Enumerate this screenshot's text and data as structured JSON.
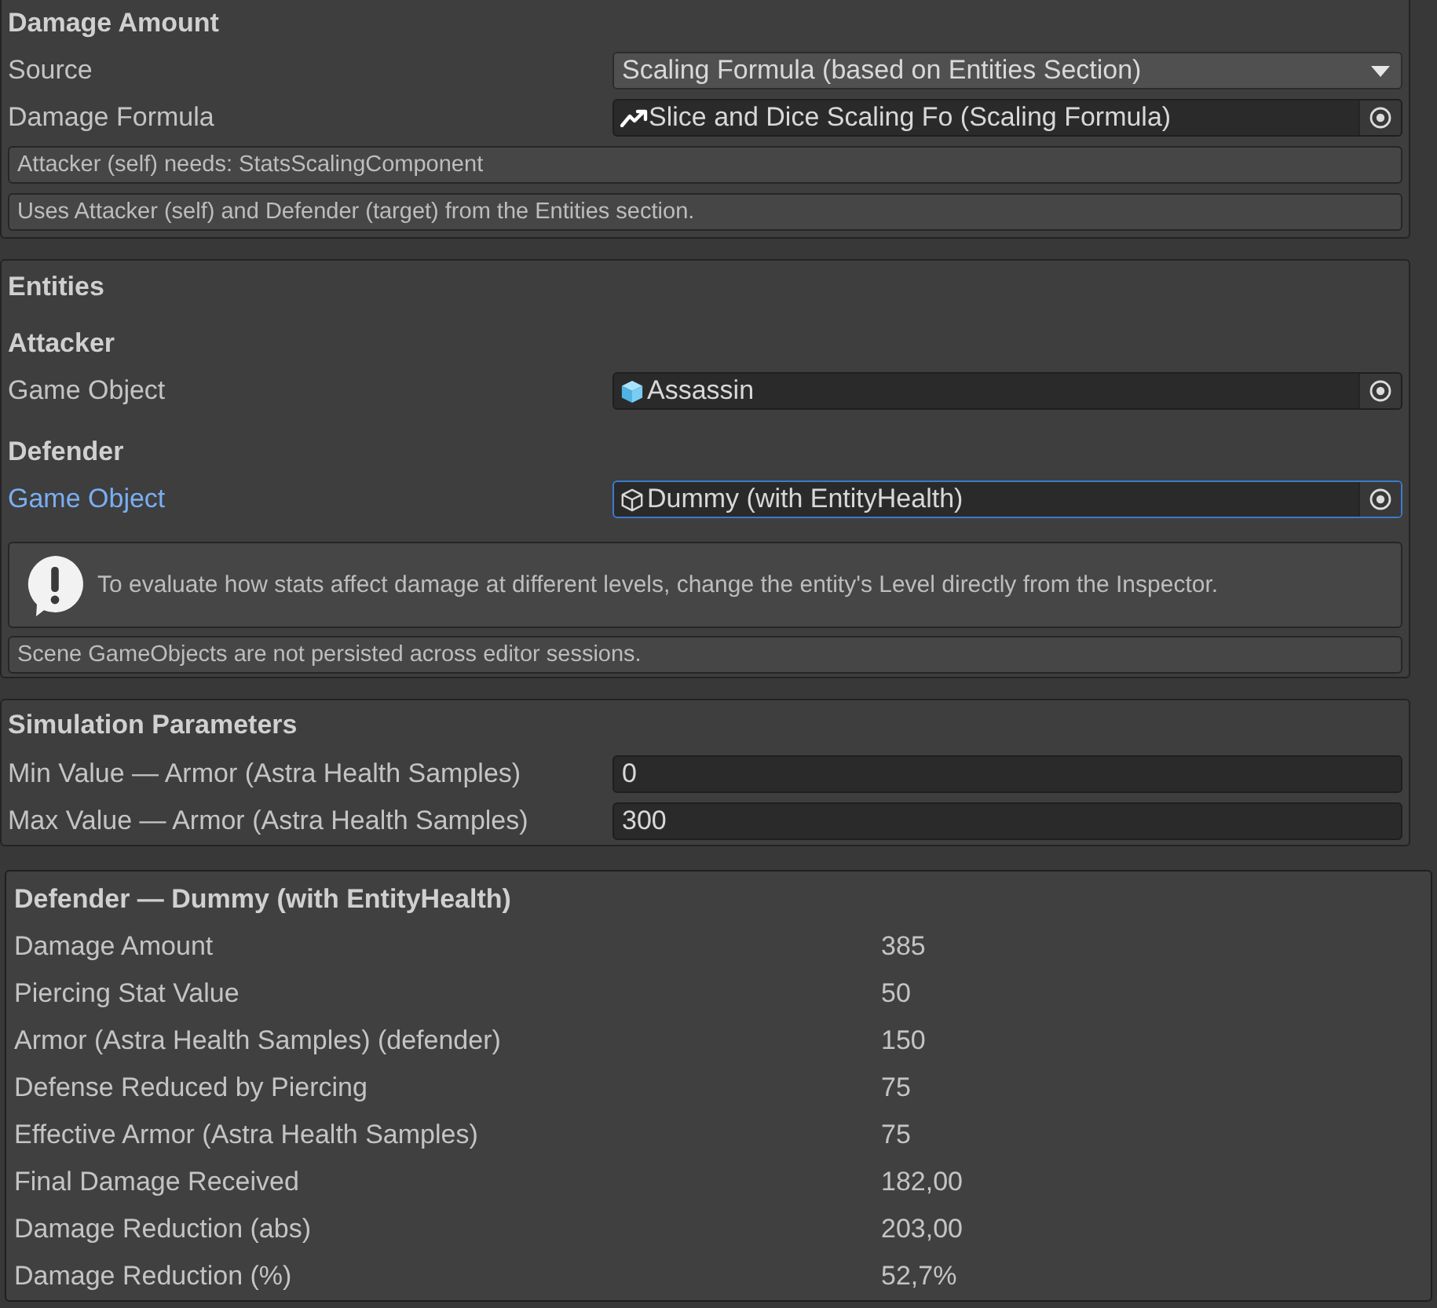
{
  "damage_amount": {
    "title": "Damage Amount",
    "fields": [
      {
        "kind": "dropdown",
        "label": "Source",
        "value": "Scaling Formula (based on Entities Section)",
        "focused": false
      },
      {
        "kind": "formula",
        "label": "Damage Formula",
        "value": "Slice and Dice Scaling Fo (Scaling Formula)",
        "focused": false
      }
    ],
    "notes": [
      {
        "kind": "plain",
        "text": "Attacker (self) needs: StatsScalingComponent"
      },
      {
        "kind": "plain",
        "text": "Uses Attacker (self) and Defender (target) from the Entities section."
      }
    ]
  },
  "entities": {
    "title": "Entities",
    "groups": [
      {
        "title": "Attacker",
        "fields": [
          {
            "kind": "prefab",
            "label": "Game Object",
            "value": "Assassin",
            "focused": false
          }
        ]
      },
      {
        "title": "Defender",
        "fields": [
          {
            "kind": "scene_object",
            "label": "Game Object",
            "value": "Dummy (with EntityHealth)",
            "focused": true
          }
        ]
      }
    ],
    "notes": [
      {
        "kind": "warning",
        "text": "To evaluate how stats affect damage at different levels, change the entity's Level directly from the Inspector."
      },
      {
        "kind": "plain",
        "text": "Scene GameObjects are not persisted across editor sessions."
      }
    ]
  },
  "simulation_parameters": {
    "title": "Simulation Parameters",
    "fields": [
      {
        "kind": "number",
        "label": "Min Value — Armor (Astra Health Samples)",
        "value": "0",
        "focused": false
      },
      {
        "kind": "number",
        "label": "Max Value — Armor (Astra Health Samples)",
        "value": "300",
        "focused": false
      }
    ]
  },
  "results": {
    "title": "Defender — Dummy (with EntityHealth)",
    "rows": [
      {
        "label": "Damage Amount",
        "value": "385"
      },
      {
        "label": "Piercing Stat Value",
        "value": "50"
      },
      {
        "label": "Armor (Astra Health Samples) (defender)",
        "value": "150"
      },
      {
        "label": "Defense Reduced by Piercing",
        "value": "75"
      },
      {
        "label": "Effective Armor (Astra Health Samples)",
        "value": "75"
      },
      {
        "label": "Final Damage Received",
        "value": "182,00"
      },
      {
        "label": "Damage Reduction (abs)",
        "value": "203,00"
      },
      {
        "label": "Damage Reduction (%)",
        "value": "52,7%"
      }
    ]
  }
}
